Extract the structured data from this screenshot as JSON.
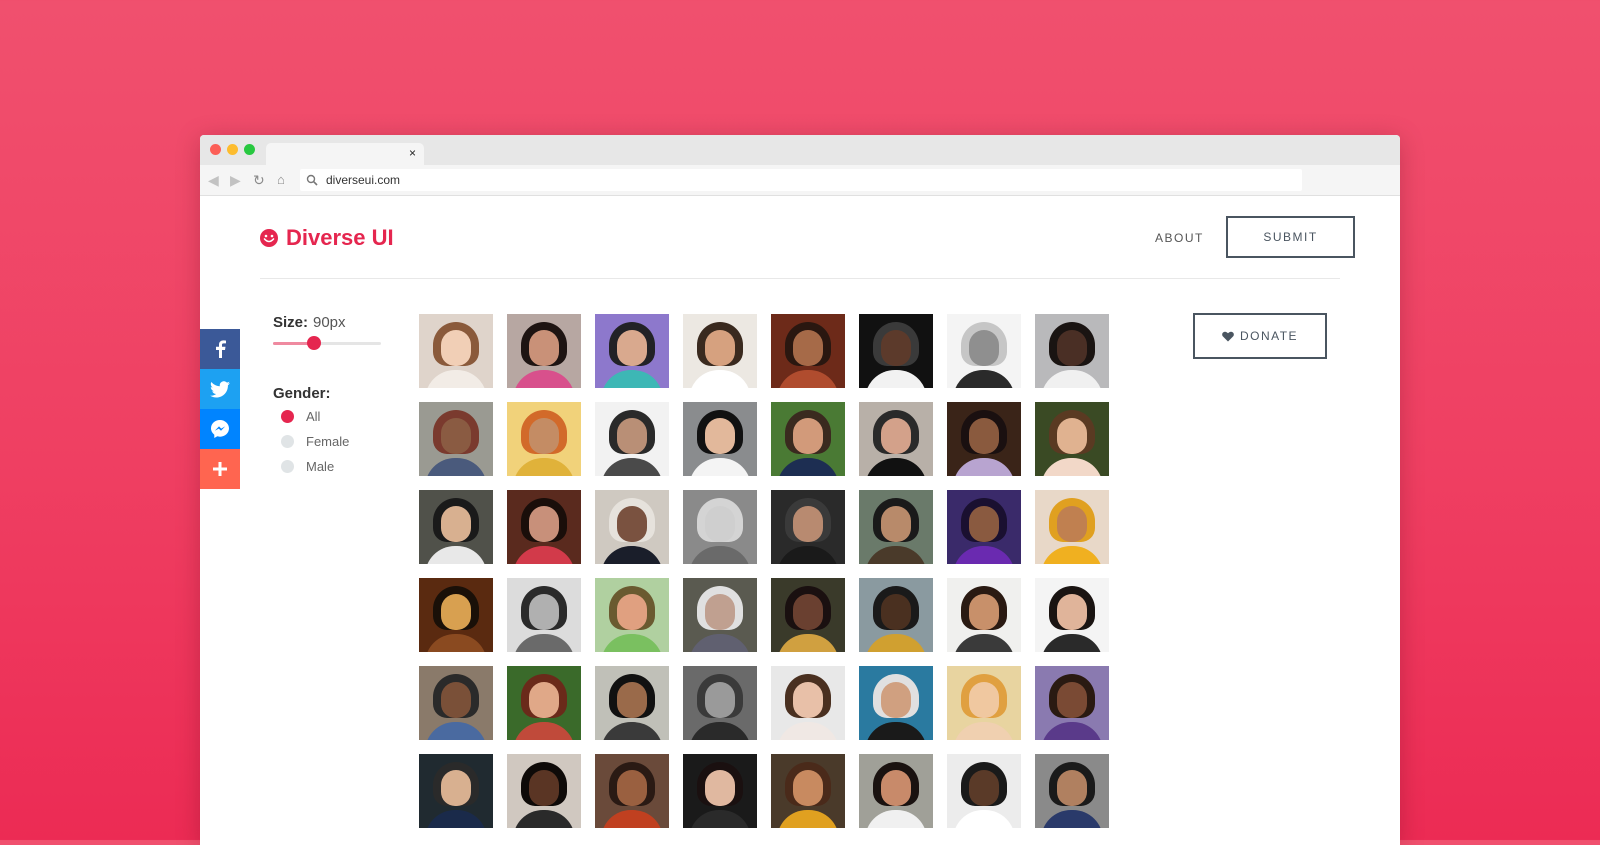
{
  "browser": {
    "url": "diverseui.com",
    "tab_close": "×"
  },
  "site": {
    "logo_text": "Diverse UI",
    "brand_color": "#e5264f",
    "nav": {
      "about": "ABOUT",
      "submit": "SUBMIT"
    },
    "donate": "DONATE"
  },
  "share": {
    "buttons": [
      {
        "name": "facebook",
        "icon": "facebook-icon",
        "color": "#3b5998"
      },
      {
        "name": "twitter",
        "icon": "twitter-icon",
        "color": "#1da1f2"
      },
      {
        "name": "messenger",
        "icon": "messenger-icon",
        "color": "#0084ff"
      },
      {
        "name": "more",
        "icon": "plus-icon",
        "color": "#ff6550"
      }
    ]
  },
  "filters": {
    "size_label": "Size:",
    "size_value": "90px",
    "size_slider_fraction": 0.38,
    "gender_label": "Gender:",
    "gender_options": [
      {
        "label": "All",
        "checked": true
      },
      {
        "label": "Female",
        "checked": false
      },
      {
        "label": "Male",
        "checked": false
      }
    ]
  },
  "photos": [
    {
      "bg": "#dfd4cb",
      "hair": "#8a5a3b",
      "skin": "#f1cfb6",
      "top": "#f2ece6"
    },
    {
      "bg": "#b7a7a2",
      "hair": "#1e1412",
      "skin": "#c99178",
      "top": "#d8508c"
    },
    {
      "bg": "#8d78cc",
      "hair": "#222226",
      "skin": "#d9a98e",
      "top": "#3db7b5"
    },
    {
      "bg": "#ece8e2",
      "hair": "#3a2a1f",
      "skin": "#d6a17f",
      "top": "#ffffff"
    },
    {
      "bg": "#6d2a19",
      "hair": "#2a1710",
      "skin": "#a66a48",
      "top": "#b04c2e"
    },
    {
      "bg": "#111111",
      "hair": "#3a3a3a",
      "skin": "#5c3a2b",
      "top": "#f2f2f2"
    },
    {
      "bg": "#f4f4f4",
      "hair": "#c6c6c6",
      "skin": "#8f8f8f",
      "top": "#2a2a2a"
    },
    {
      "bg": "#b9b9bb",
      "hair": "#1a1412",
      "skin": "#4a2f25",
      "top": "#f0f0f0"
    },
    {
      "bg": "#9a9a92",
      "hair": "#7a3a2e",
      "skin": "#8a5b42",
      "top": "#4a5a7c"
    },
    {
      "bg": "#f1d27a",
      "hair": "#d26a2a",
      "skin": "#c48c64",
      "top": "#e0b23a"
    },
    {
      "bg": "#f2f2f2",
      "hair": "#2a2a2a",
      "skin": "#b98f76",
      "top": "#4a4a4a"
    },
    {
      "bg": "#8a8c8e",
      "hair": "#111111",
      "skin": "#e2b89b",
      "top": "#f4f4f4"
    },
    {
      "bg": "#4a7a34",
      "hair": "#3a2a1f",
      "skin": "#d29a7a",
      "top": "#1d2e52"
    },
    {
      "bg": "#b8b0a8",
      "hair": "#2a2a2a",
      "skin": "#d3a18a",
      "top": "#111111"
    },
    {
      "bg": "#3a2418",
      "hair": "#1a1010",
      "skin": "#8a5a3e",
      "top": "#b8a4d0"
    },
    {
      "bg": "#3a4a24",
      "hair": "#5a3a22",
      "skin": "#e0b290",
      "top": "#f2d8c8"
    },
    {
      "bg": "#50514a",
      "hair": "#1a1a1a",
      "skin": "#d8b090",
      "top": "#e8e8e8"
    },
    {
      "bg": "#5a2a1e",
      "hair": "#1a0e0a",
      "skin": "#c8907a",
      "top": "#d23a4a"
    },
    {
      "bg": "#cfc9c1",
      "hair": "#e6e2dc",
      "skin": "#7a5240",
      "top": "#1a1e2a"
    },
    {
      "bg": "#8a8a8a",
      "hair": "#d4d4d4",
      "skin": "#cfcfcf",
      "top": "#6a6a6a"
    },
    {
      "bg": "#2a2a2a",
      "hair": "#3a3a3a",
      "skin": "#b88a70",
      "top": "#1a1a1a"
    },
    {
      "bg": "#6a7a6a",
      "hair": "#1a1a1a",
      "skin": "#b88a6a",
      "top": "#4a3a2a"
    },
    {
      "bg": "#3a2a6a",
      "hair": "#1a1030",
      "skin": "#8a5a40",
      "top": "#6a2ab0"
    },
    {
      "bg": "#e8d8c8",
      "hair": "#e0a020",
      "skin": "#c08050",
      "top": "#f0b020"
    },
    {
      "bg": "#5a2a10",
      "hair": "#1a1008",
      "skin": "#d8a050",
      "top": "#8a4a20"
    },
    {
      "bg": "#dcdcdc",
      "hair": "#2a2a2a",
      "skin": "#b0b0b0",
      "top": "#6a6a6a"
    },
    {
      "bg": "#b0d0a0",
      "hair": "#6a5a30",
      "skin": "#e0a080",
      "top": "#7ac060"
    },
    {
      "bg": "#5a5a50",
      "hair": "#e0e0e0",
      "skin": "#c0a090",
      "top": "#606070"
    },
    {
      "bg": "#3a3a2a",
      "hair": "#1a1010",
      "skin": "#6a4030",
      "top": "#d0a040"
    },
    {
      "bg": "#8a9aa0",
      "hair": "#1a1a1a",
      "skin": "#4a3020",
      "top": "#d0a030"
    },
    {
      "bg": "#f0f0ee",
      "hair": "#2a1a12",
      "skin": "#c8906a",
      "top": "#3a3a3a"
    },
    {
      "bg": "#f4f4f4",
      "hair": "#1a1412",
      "skin": "#e0b49a",
      "top": "#2a2a2a"
    },
    {
      "bg": "#8a7a6a",
      "hair": "#2a2a2a",
      "skin": "#7a5038",
      "top": "#4a6aa0"
    },
    {
      "bg": "#3a6a2a",
      "hair": "#6a2a1a",
      "skin": "#e0a888",
      "top": "#c04a3a"
    },
    {
      "bg": "#c0c0b8",
      "hair": "#111111",
      "skin": "#9a6a4a",
      "top": "#3a3a3a"
    },
    {
      "bg": "#6a6a6a",
      "hair": "#3a3a3a",
      "skin": "#9a9a9a",
      "top": "#2a2a2a"
    },
    {
      "bg": "#e8e8e8",
      "hair": "#4a3020",
      "skin": "#e8c0a8",
      "top": "#f0e8e4"
    },
    {
      "bg": "#2a7aa0",
      "hair": "#e0e0e0",
      "skin": "#d0a080",
      "top": "#1a1a1a"
    },
    {
      "bg": "#e8d4a0",
      "hair": "#e0a040",
      "skin": "#f0c8a0",
      "top": "#f0d0b0"
    },
    {
      "bg": "#8a7ab0",
      "hair": "#2a1a12",
      "skin": "#7a4a34",
      "top": "#5a3a8a"
    },
    {
      "bg": "#202a30",
      "hair": "#2a2a2a",
      "skin": "#d8b090",
      "top": "#1a2a4a"
    },
    {
      "bg": "#d0c8c0",
      "hair": "#0e0a08",
      "skin": "#5a3524",
      "top": "#2a2a2a"
    },
    {
      "bg": "#6a4a3a",
      "hair": "#2a1a14",
      "skin": "#9a6040",
      "top": "#c04020"
    },
    {
      "bg": "#1a1a1a",
      "hair": "#1a1010",
      "skin": "#e0b8a0",
      "top": "#2a2a2a"
    },
    {
      "bg": "#4a3a2a",
      "hair": "#4a2a1a",
      "skin": "#c88a60",
      "top": "#e0a020"
    },
    {
      "bg": "#a0a098",
      "hair": "#1a1210",
      "skin": "#c88a6a",
      "top": "#f0f0f0"
    },
    {
      "bg": "#ececec",
      "hair": "#1a1a1a",
      "skin": "#5a3a28",
      "top": "#ffffff"
    },
    {
      "bg": "#8a8a8a",
      "hair": "#1a1a1a",
      "skin": "#b08060",
      "top": "#2a3a6a"
    }
  ]
}
